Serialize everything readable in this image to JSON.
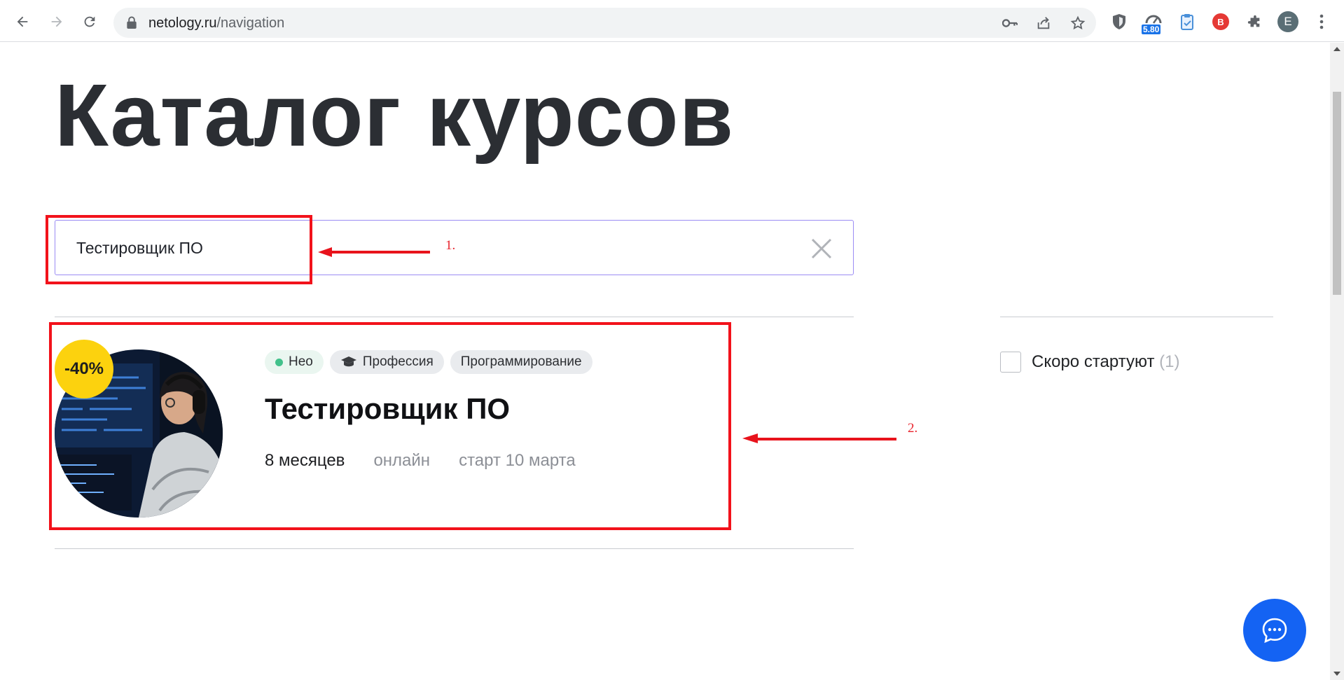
{
  "browser": {
    "url_domain": "netology.ru",
    "url_path": "/navigation",
    "profile_initial": "E",
    "extension_badge": "5.80"
  },
  "page": {
    "title": "Каталог курсов"
  },
  "search": {
    "value": "Тестировщик ПО"
  },
  "course": {
    "discount": "-40%",
    "tags": [
      {
        "label": "Нео"
      },
      {
        "label": "Профессия"
      },
      {
        "label": "Программирование"
      }
    ],
    "title": "Тестировщик ПО",
    "duration": "8 месяцев",
    "format": "онлайн",
    "start": "старт 10 марта"
  },
  "filters": {
    "soon_label": "Скоро стартуют",
    "soon_count": "(1)"
  },
  "annotations": {
    "label1": "1.",
    "label2": "2."
  },
  "colors": {
    "accent_purple": "#9b8cf4",
    "discount_yellow": "#fcd20e",
    "chat_blue": "#1463f3",
    "annotation_red": "#f2121b",
    "neo_green": "#42c18b"
  }
}
